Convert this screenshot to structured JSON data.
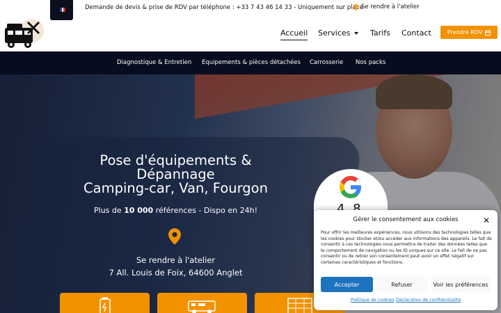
{
  "topbar": {
    "language": "fr",
    "info_text": "Demande de devis & prise de RDV par téléphone : +33 7 43 46 14 33 - Uniquement sur place",
    "map_link": "Se rendre à l'atelier"
  },
  "nav": {
    "items": [
      "Accueil",
      "Services",
      "Tarifs",
      "Contact"
    ],
    "active": "Accueil",
    "cta": "Prendre RDV"
  },
  "subnav": {
    "items": [
      "Diagnostique & Entretien",
      "Equipements & pièces détachées",
      "Carrosserie",
      "Nos packs"
    ]
  },
  "hero": {
    "title_line1": "Pose d'équipements &",
    "title_line2": "Dépannage",
    "title_line3": "Camping-car, Van, Fourgon",
    "subtitle_pre": "Plus de ",
    "subtitle_bold": "10 000",
    "subtitle_post": " références - Dispo en 24h!",
    "address_line1": "Se rendre à l'atelier",
    "address_line2": "7 All. Louis de Foix, 64600 Anglet",
    "google_rating": "4.8"
  },
  "cookie": {
    "title": "Gérer le consentement aux cookies",
    "body": "Pour offrir les meilleures expériences, nous utilisons des technologies telles que les cookies pour stocker et/ou accéder aux informations des appareils. Le fait de consentir à ces technologies nous permettra de traiter des données telles que le comportement de navigation ou les ID uniques sur ce site. Le fait de ne pas consentir ou de retirer son consentement peut avoir un effet négatif sur certaines caractéristiques et fonctions.",
    "accept": "Accepter",
    "refuse": "Refuser",
    "prefs": "Voir les préférences",
    "link_cookies": "Politique de cookies",
    "link_privacy": "Déclaration de confidentialité"
  },
  "colors": {
    "accent": "#f39200",
    "navy": "#070c1e",
    "button_blue": "#1e73be"
  }
}
